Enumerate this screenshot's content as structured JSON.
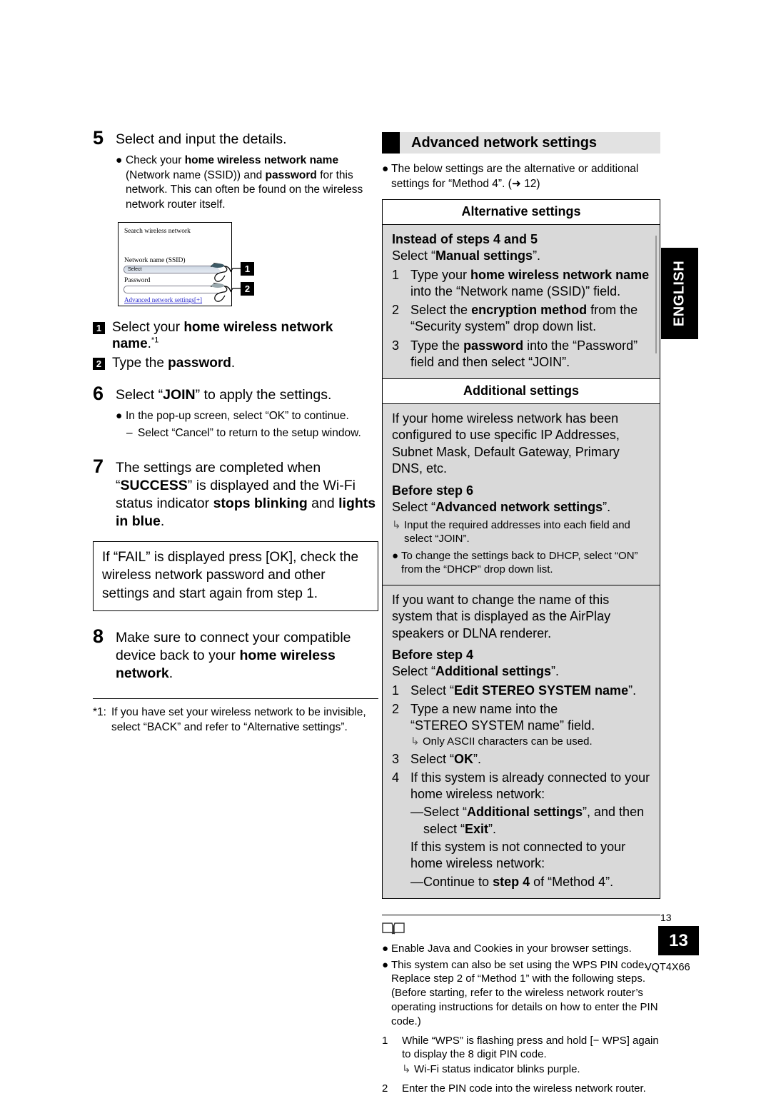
{
  "left": {
    "step5": {
      "num": "5",
      "title": "Select and input the details.",
      "bullet": "Check your home wireless network name (Network name (SSID)) and password for this network. This can often be found on the wireless network router itself."
    },
    "diagram": {
      "title": "Search wireless network",
      "ssid_label": "Network name (SSID)",
      "ssid_value": "Select",
      "password_label": "Password",
      "password_value": "",
      "advanced_link": "Advanced network settings[+]",
      "badge1": "1",
      "badge2": "2"
    },
    "callouts": [
      {
        "badge": "1",
        "text": "Select your home wireless network name.*1"
      },
      {
        "badge": "2",
        "text": "Type the password."
      }
    ],
    "step6": {
      "num": "6",
      "title": "Select “JOIN” to apply the settings.",
      "bullet": "In the pop-up screen, select “OK” to continue.",
      "dash": "Select “Cancel” to return to the setup window."
    },
    "step7": {
      "num": "7",
      "line1": "The settings are completed when “SUCCESS”",
      "line2": "is displayed and the Wi-Fi status indicator",
      "line3_bold_a": "stops blinking",
      "line3_mid": " and ",
      "line3_bold_b": "lights in blue",
      "line3_end": "."
    },
    "fail_note": "If “FAIL” is displayed press [OK], check the wireless network password and other settings and start again from step 1.",
    "step8": {
      "num": "8",
      "line1": "Make sure to connect your compatible device",
      "line2_pre": "back to your ",
      "line2_bold": "home wireless network",
      "line2_end": "."
    },
    "footnote": {
      "marker": "*1:",
      "text": "If you have set your wireless network to be invisible, select “BACK” and refer to “Alternative settings”."
    }
  },
  "right": {
    "header_title": "Advanced network settings",
    "intro": "The below settings are the alternative or additional settings for “Method 4”. (➜ 12)",
    "alternative": {
      "head": "Alternative settings",
      "sub_bold": "Instead of steps 4 and 5",
      "sub_norm_pre": "Select “",
      "sub_norm_bold": "Manual settings",
      "sub_norm_end": "”.",
      "items": [
        {
          "n": "1",
          "line1_pre": "Type your ",
          "line1_bold": "home wireless network name",
          "line2": "into the “Network name (SSID)” field."
        },
        {
          "n": "2",
          "line1_pre": "Select the ",
          "line1_bold": "encryption method",
          "line1_post": " from the",
          "line2": "“Security system” drop down list."
        },
        {
          "n": "3",
          "line1_pre": "Type the ",
          "line1_bold": "password",
          "line1_post": " into the “Password” field",
          "line2": "and then select “JOIN”."
        }
      ]
    },
    "additional": {
      "head": "Additional settings",
      "block1": {
        "intro": "If your home wireless network has been configured to use specific IP Addresses, Subnet Mask, Default Gateway, Primary DNS, etc.",
        "before_bold": "Before step 6",
        "select_pre": "Select “",
        "select_bold": "Advanced network settings",
        "select_end": "”.",
        "arrow": "Input the required addresses into each field and select “JOIN”.",
        "bullet": "To change the settings back to DHCP, select “ON” from the “DHCP” drop down list."
      },
      "block2": {
        "intro": "If you want to change the name of this system that is displayed as the AirPlay speakers or DLNA renderer.",
        "before_bold": "Before step 4",
        "select_pre": "Select “",
        "select_bold": "Additional settings",
        "select_end": "”.",
        "items": [
          {
            "n": "1",
            "pre": "Select “",
            "bold": "Edit STEREO SYSTEM name",
            "post": "”."
          },
          {
            "n": "2",
            "line1": "Type a new name into the",
            "line2": "“STEREO SYSTEM name” field.",
            "arrow": "Only ASCII characters can be used."
          },
          {
            "n": "3",
            "pre": "Select “",
            "bold": "OK",
            "post": "”."
          },
          {
            "n": "4",
            "line1": "If this system is already connected to your",
            "line2": "home wireless network:",
            "dash1_pre": "Select “",
            "dash1_bold": "Additional settings",
            "dash1_post": "”, and then",
            "dash1_line2_pre": "select “",
            "dash1_line2_bold": "Exit",
            "dash1_line2_post": "”.",
            "line3": "If this system is not connected to your home",
            "line4": "wireless network:",
            "dash2_pre": "Continue to ",
            "dash2_bold": "step 4",
            "dash2_post": " of “Method 4”."
          }
        ]
      }
    },
    "notes": {
      "bullets": [
        "Enable Java and Cookies in your browser settings.",
        "This system can also be set using the WPS PIN code. Replace step 2 of “Method 1” with the following steps. (Before starting, refer to the wireless network router’s operating instructions for details on how to enter the PIN code.)"
      ],
      "steps": [
        {
          "n": "1",
          "text": "While “WPS” is flashing press and hold [− WPS] again to display the 8 digit PIN code.",
          "arrow": "Wi-Fi status indicator blinks purple."
        },
        {
          "n": "2",
          "text": "Enter the PIN code into the wireless network router."
        }
      ]
    }
  },
  "side_tab": {
    "label": "ENGLISH"
  },
  "footer": {
    "page_small": "13",
    "page_box": "13",
    "doc_code": "VQT4X66"
  }
}
